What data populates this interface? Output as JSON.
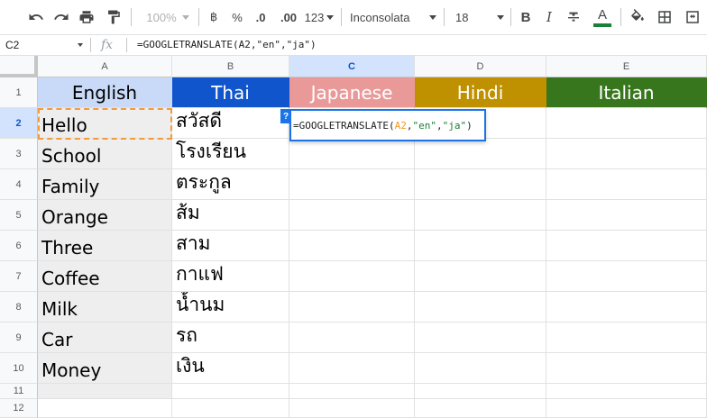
{
  "toolbar": {
    "zoom": "100%",
    "currency": "฿",
    "percent": "%",
    "decrease_decimals": ".0",
    "increase_decimals": ".00",
    "number_format": "123",
    "font_name": "Inconsolata",
    "font_size": "18",
    "bold": "B",
    "italic": "I",
    "text_color_letter": "A",
    "text_color_bar": "#188038"
  },
  "formula_bar": {
    "name_box": "C2",
    "fx": "fx",
    "formula": "=GOOGLETRANSLATE(A2,\"en\",\"ja\")"
  },
  "columns": [
    "A",
    "B",
    "C",
    "D",
    "E"
  ],
  "rows": [
    "1",
    "2",
    "3",
    "4",
    "5",
    "6",
    "7",
    "8",
    "9",
    "10",
    "11",
    "12"
  ],
  "headers": [
    {
      "label": "English",
      "bg": "#c9daf8",
      "fg": "#000000"
    },
    {
      "label": "Thai",
      "bg": "#1155cc",
      "fg": "#ffffff"
    },
    {
      "label": "Japanese",
      "bg": "#ea9999",
      "fg": "#ffffff"
    },
    {
      "label": "Hindi",
      "bg": "#bf9000",
      "fg": "#ffffff"
    },
    {
      "label": "Italian",
      "bg": "#38761d",
      "fg": "#ffffff"
    }
  ],
  "english": [
    "Hello",
    "School",
    "Family",
    "Orange",
    "Three",
    "Coffee",
    "Milk",
    "Car",
    "Money"
  ],
  "thai": [
    "สวัสดี",
    "โรงเรียน",
    "ตระกูล",
    "ส้ม",
    "สาม",
    "กาแฟ",
    "น้ำนม",
    "รถ",
    "เงิน"
  ],
  "editor": {
    "badge": "?",
    "func": "=GOOGLETRANSLATE(",
    "ref": "A2",
    "comma1": ",",
    "arg1": "\"en\"",
    "comma2": ",",
    "arg2": "\"ja\"",
    "close": ")"
  }
}
